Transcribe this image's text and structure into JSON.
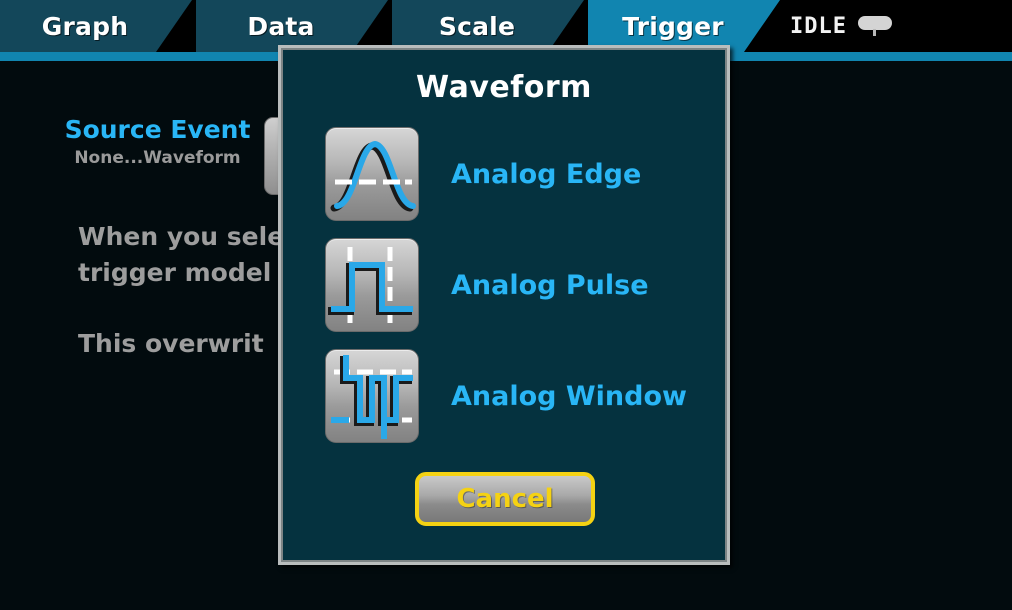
{
  "tabs": [
    {
      "id": "graph",
      "label": "Graph",
      "active": false
    },
    {
      "id": "data",
      "label": "Data",
      "active": false
    },
    {
      "id": "scale",
      "label": "Scale",
      "active": false
    },
    {
      "id": "trigger",
      "label": "Trigger",
      "active": true
    }
  ],
  "status": {
    "text": "IDLE",
    "icon": "connector-pill-icon"
  },
  "background": {
    "source_event": {
      "title": "Source Event",
      "range": "None...Waveform",
      "button_value": ""
    },
    "description_line_1": "When you sele                        ilEvent",
    "description_line_2": "trigger model",
    "description_line_3": "This overwrit"
  },
  "dialog": {
    "title": "Waveform",
    "options": [
      {
        "id": "analog-edge",
        "label": "Analog Edge",
        "icon": "analog-edge-icon"
      },
      {
        "id": "analog-pulse",
        "label": "Analog Pulse",
        "icon": "analog-pulse-icon"
      },
      {
        "id": "analog-window",
        "label": "Analog Window",
        "icon": "analog-window-icon"
      }
    ],
    "cancel_label": "Cancel"
  },
  "colors": {
    "accent_cyan": "#29b6f6",
    "tab_active": "#1185b0",
    "tab_inactive": "#13475a",
    "dialog_bg": "#05323f",
    "focus_yellow": "#f5d213",
    "body_bg": "#020b0e"
  }
}
